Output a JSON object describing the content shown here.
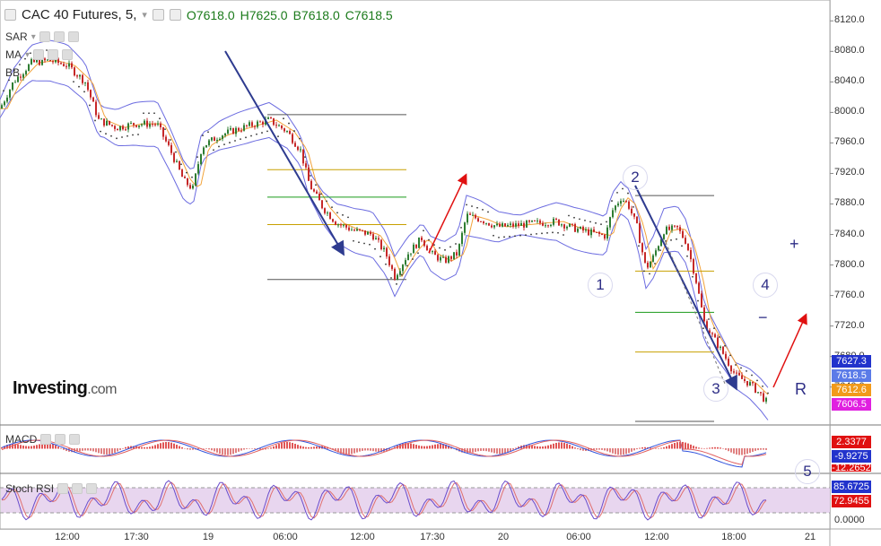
{
  "header": {
    "symbol": "CAC 40 Futures, 5,",
    "open": "O7618.0",
    "high": "H7625.0",
    "low": "B7618.0",
    "close": "C7618.5"
  },
  "indicators": {
    "sar": "SAR",
    "ma": "MA",
    "bb": "BB",
    "macd": "MACD",
    "stoch": "Stoch RSI"
  },
  "logo": {
    "main": "Investing",
    "suffix": ".com"
  },
  "price_labels": {
    "p1": "7627.3",
    "p2": "7618.5",
    "p3": "7612.6",
    "p4": "7606.5"
  },
  "macd_labels": {
    "m1": "2.3377",
    "m2": "-9.9275",
    "m3": "-12.2652"
  },
  "stoch_labels": {
    "s1": "85.6725",
    "s2": "72.9455",
    "s3": "0.0000"
  },
  "wave_labels": {
    "w1": "1",
    "w2": "2",
    "w3": "3",
    "w4": "4",
    "w5": "5",
    "r": "R",
    "plus": "+",
    "minus": "−"
  },
  "colors": {
    "up": "#2e7d32",
    "down": "#c62828",
    "bb": "#6b6be0",
    "arrow_blue": "#2e3b8f",
    "arrow_red": "#e01010",
    "tag_blue": "#2233cc",
    "tag_lightblue": "#5b7be8",
    "tag_orange": "#f29a1a",
    "tag_magenta": "#e020e0"
  },
  "chart_data": {
    "type": "candlestick",
    "price_axis": {
      "ticks": [
        "8120.0",
        "8080.0",
        "8040.0",
        "8000.0",
        "7960.0",
        "7920.0",
        "7880.0",
        "7840.0",
        "7800.0",
        "7760.0",
        "7720.0",
        "7680.0",
        "7640.0"
      ],
      "range": [
        7595,
        8145
      ]
    },
    "time_axis": {
      "ticks": [
        "12:00",
        "17:30",
        "19",
        "06:00",
        "12:00",
        "17:30",
        "20",
        "06:00",
        "12:00",
        "18:00",
        "21"
      ]
    },
    "price_path": [
      [
        0,
        8005
      ],
      [
        15,
        8040
      ],
      [
        35,
        8065
      ],
      [
        55,
        8068
      ],
      [
        75,
        8062
      ],
      [
        95,
        8040
      ],
      [
        110,
        7990
      ],
      [
        130,
        7980
      ],
      [
        150,
        7985
      ],
      [
        175,
        7985
      ],
      [
        190,
        7950
      ],
      [
        205,
        7910
      ],
      [
        215,
        7900
      ],
      [
        225,
        7955
      ],
      [
        245,
        7970
      ],
      [
        265,
        7978
      ],
      [
        285,
        7985
      ],
      [
        300,
        7990
      ],
      [
        320,
        7975
      ],
      [
        335,
        7950
      ],
      [
        345,
        7905
      ],
      [
        360,
        7875
      ],
      [
        375,
        7855
      ],
      [
        395,
        7845
      ],
      [
        415,
        7840
      ],
      [
        430,
        7815
      ],
      [
        440,
        7785
      ],
      [
        455,
        7815
      ],
      [
        470,
        7835
      ],
      [
        480,
        7815
      ],
      [
        495,
        7805
      ],
      [
        510,
        7815
      ],
      [
        520,
        7865
      ],
      [
        535,
        7860
      ],
      [
        555,
        7850
      ],
      [
        575,
        7852
      ],
      [
        600,
        7855
      ],
      [
        620,
        7857
      ],
      [
        640,
        7848
      ],
      [
        660,
        7842
      ],
      [
        675,
        7838
      ],
      [
        682,
        7870
      ],
      [
        692,
        7888
      ],
      [
        700,
        7880
      ],
      [
        710,
        7850
      ],
      [
        720,
        7795
      ],
      [
        728,
        7810
      ],
      [
        740,
        7845
      ],
      [
        755,
        7848
      ],
      [
        765,
        7830
      ],
      [
        775,
        7785
      ],
      [
        785,
        7725
      ],
      [
        795,
        7705
      ],
      [
        808,
        7680
      ],
      [
        820,
        7655
      ],
      [
        835,
        7645
      ],
      [
        848,
        7630
      ],
      [
        856,
        7618
      ]
    ],
    "fib_levels": [
      {
        "x": [
          298,
          453
        ],
        "price": 7997,
        "color": "#555555"
      },
      {
        "x": [
          298,
          453
        ],
        "price": 7925,
        "color": "#c8a000"
      },
      {
        "x": [
          298,
          453
        ],
        "price": 7889,
        "color": "#1a9a1a"
      },
      {
        "x": [
          298,
          453
        ],
        "price": 7853,
        "color": "#c8a000"
      },
      {
        "x": [
          298,
          453
        ],
        "price": 7781,
        "color": "#555555"
      },
      {
        "x": [
          708,
          796
        ],
        "price": 7891,
        "color": "#555555"
      },
      {
        "x": [
          708,
          796
        ],
        "price": 7792,
        "color": "#c8a000"
      },
      {
        "x": [
          708,
          796
        ],
        "price": 7738,
        "color": "#1a9a1a"
      },
      {
        "x": [
          708,
          796
        ],
        "price": 7686,
        "color": "#c8a000"
      },
      {
        "x": [
          708,
          796
        ],
        "price": 7595,
        "color": "#555555"
      }
    ]
  }
}
